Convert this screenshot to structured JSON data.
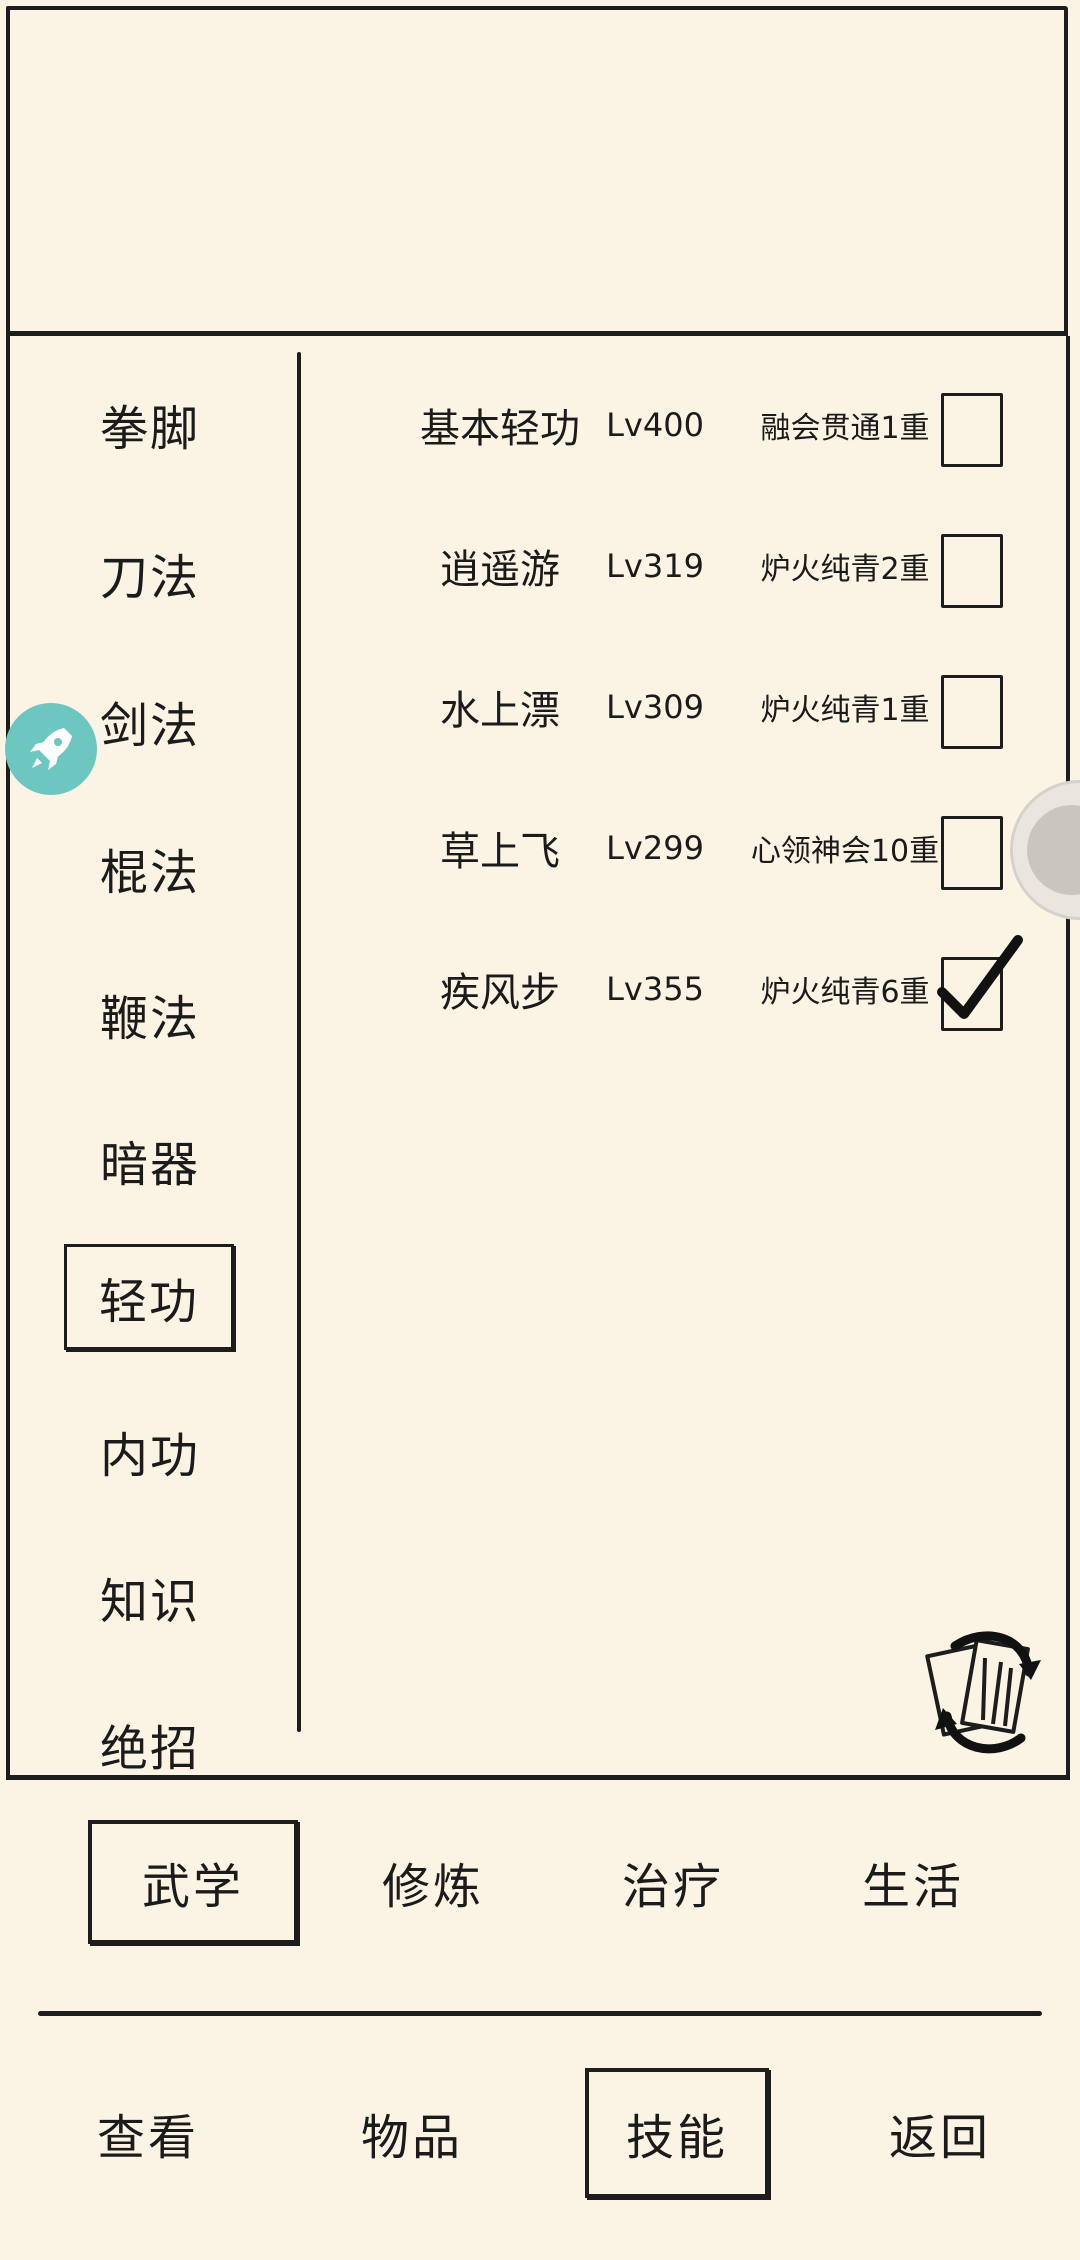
{
  "categories": [
    "拳脚",
    "刀法",
    "剑法",
    "棍法",
    "鞭法",
    "暗器",
    "轻功",
    "内功",
    "知识",
    "绝招"
  ],
  "selected_category": "轻功",
  "skills": [
    {
      "name": "基本轻功",
      "level": "Lv400",
      "rank": "融会贯通1重",
      "checked": false
    },
    {
      "name": "逍遥游",
      "level": "Lv319",
      "rank": "炉火纯青2重",
      "checked": false
    },
    {
      "name": "水上漂",
      "level": "Lv309",
      "rank": "炉火纯青1重",
      "checked": false
    },
    {
      "name": "草上飞",
      "level": "Lv299",
      "rank": "心领神会10重",
      "checked": false
    },
    {
      "name": "疾风步",
      "level": "Lv355",
      "rank": "炉火纯青6重",
      "checked": true
    }
  ],
  "tabs": [
    "武学",
    "修炼",
    "治疗",
    "生活"
  ],
  "selected_tab": "武学",
  "nav": [
    "查看",
    "物品",
    "技能",
    "返回"
  ],
  "selected_nav": "技能",
  "icons": {
    "float": "rocket-icon",
    "refresh": "swap-cards-icon",
    "side": "floating-handle-icon"
  },
  "colors": {
    "background": "#fbf4e4",
    "ink": "#1d1d1d",
    "float_button": "#6dc7c0"
  }
}
